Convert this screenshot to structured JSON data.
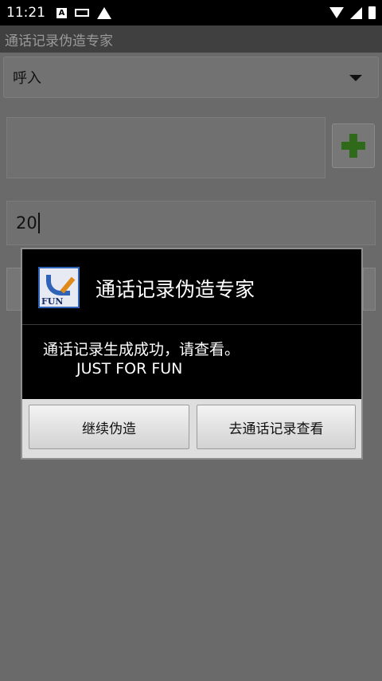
{
  "status_bar": {
    "time": "11:21",
    "badge_letter": "A"
  },
  "app": {
    "title": "通话记录伪造专家"
  },
  "form": {
    "call_type": "呼入",
    "count_value": "20"
  },
  "dialog": {
    "title": "通话记录伪造专家",
    "icon_text": "FUN",
    "message_line1": "通话记录生成成功，请查看。",
    "message_line2": "JUST FOR FUN",
    "continue_label": "继续伪造",
    "view_label": "去通话记录查看"
  },
  "colors": {
    "dialog_background": "#000000",
    "dim_overlay": "#6a6a6a",
    "add_icon_green": "#2e6a1a",
    "icon_blue": "#2f63b8"
  }
}
